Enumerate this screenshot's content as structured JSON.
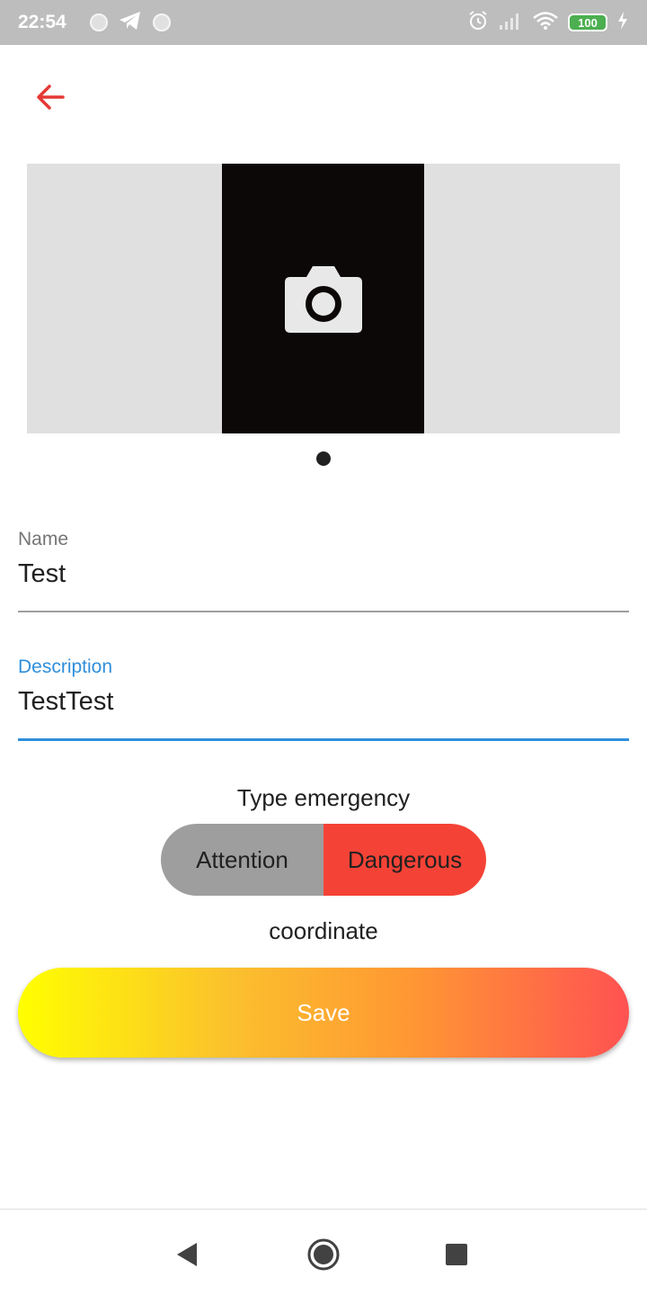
{
  "status_bar": {
    "time": "22:54",
    "battery": "100",
    "icons": [
      "notification-dot-icon",
      "telegram-icon",
      "notification-dot-icon",
      "alarm-icon",
      "signal-icon",
      "wifi-icon",
      "battery-icon",
      "charging-icon"
    ]
  },
  "header": {
    "back_icon": "arrow-left-icon"
  },
  "carousel": {
    "slot_icon": "camera-icon",
    "page_count": 1,
    "current_page": 1
  },
  "form": {
    "name": {
      "label": "Name",
      "value": "Test"
    },
    "description": {
      "label": "Description",
      "value": "TestTest"
    }
  },
  "emergency": {
    "title": "Type emergency",
    "options": [
      {
        "label": "Attention",
        "color": "#9e9e9e"
      },
      {
        "label": "Dangerous",
        "color": "#f44336"
      }
    ],
    "selected": "Dangerous"
  },
  "coordinate_label": "coordinate",
  "save_label": "Save",
  "colors": {
    "accent": "#e53935",
    "focus": "#2f8fdc",
    "gradient_start": "#ffff00",
    "gradient_end": "#ff5252"
  },
  "navigation": [
    "back-icon",
    "home-icon",
    "recents-icon"
  ]
}
